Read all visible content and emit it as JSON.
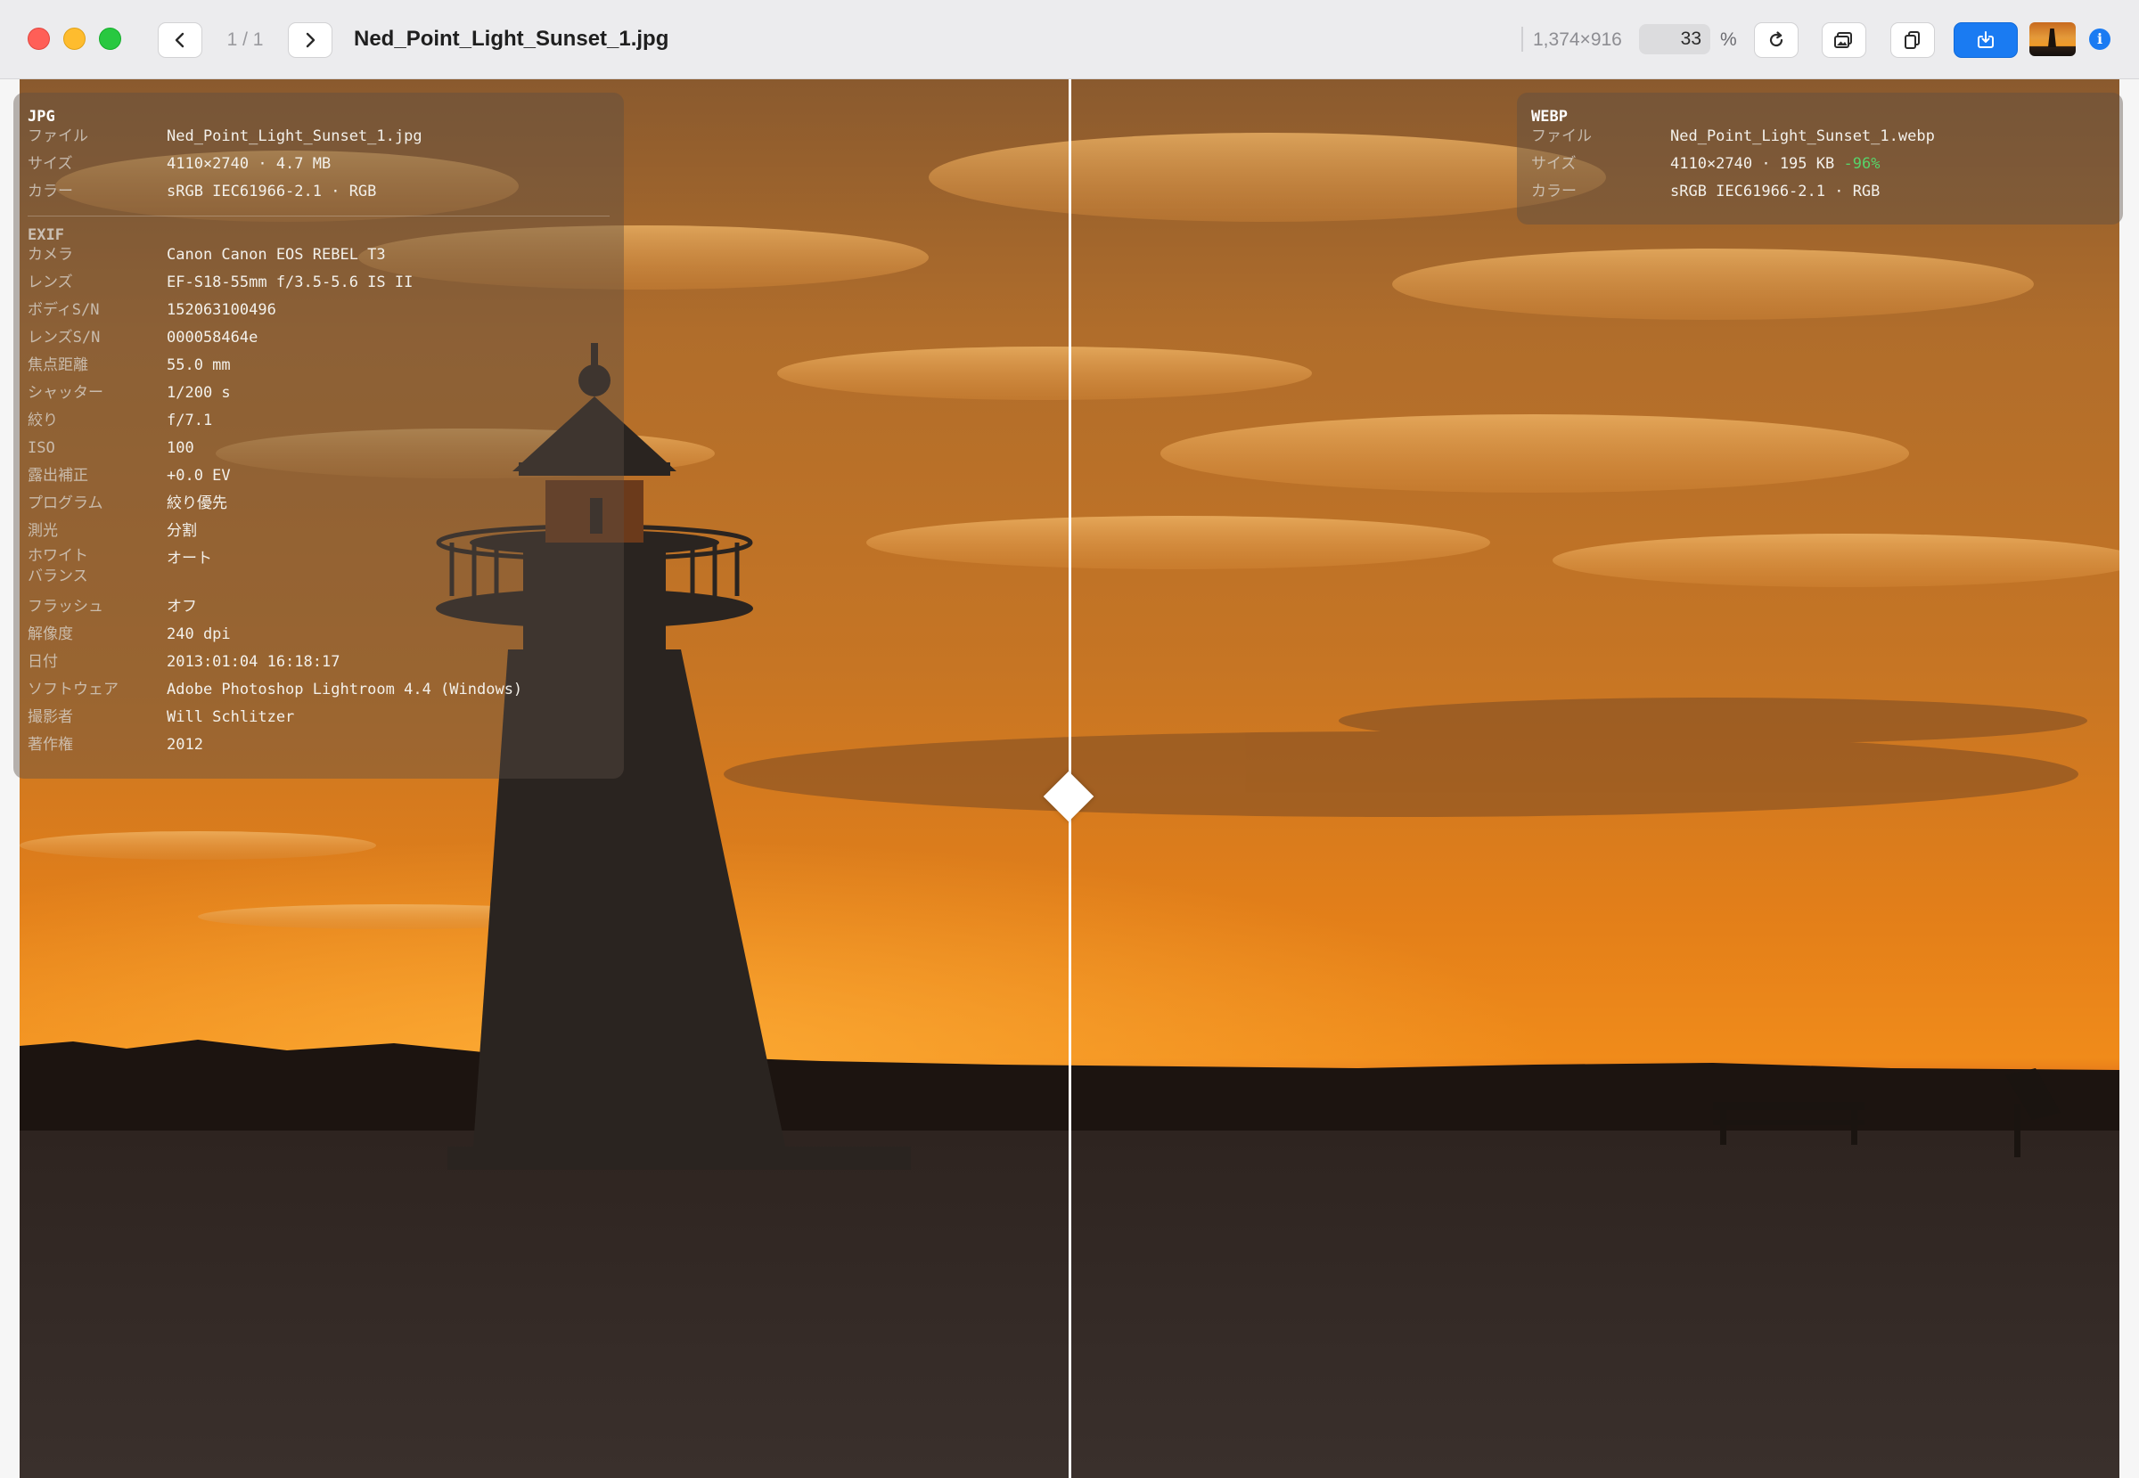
{
  "titlebar": {
    "counter": "1 / 1",
    "filename": "Ned_Point_Light_Sunset_1.jpg",
    "dimensions": "1,374×916",
    "zoom_value": "33",
    "zoom_unit": "%",
    "info_glyph": "i"
  },
  "icons": {
    "prev": "chevron-left-icon",
    "next": "chevron-right-icon",
    "rotate": "rotate-icon",
    "compare": "image-compare-icon",
    "copy": "copy-icon",
    "save": "save-download-icon",
    "info": "info-icon"
  },
  "colors": {
    "accent": "#1a7bf2",
    "size_delta": "#57d36a"
  },
  "left_panel": {
    "title": "JPG",
    "rows": [
      {
        "label": "ファイル",
        "value": "Ned_Point_Light_Sunset_1.jpg"
      },
      {
        "label": "サイズ",
        "value": "4110×2740 · 4.7 MB"
      },
      {
        "label": "カラー",
        "value": "sRGB IEC61966-2.1 · RGB"
      }
    ],
    "exif_title": "EXIF",
    "exif": [
      {
        "label": "カメラ",
        "value": "Canon Canon EOS REBEL T3"
      },
      {
        "label": "レンズ",
        "value": "EF-S18-55mm f/3.5-5.6 IS II"
      },
      {
        "label": "ボディS/N",
        "value": "152063100496"
      },
      {
        "label": "レンズS/N",
        "value": "000058464e"
      },
      {
        "label": "焦点距離",
        "value": "55.0 mm"
      },
      {
        "label": "シャッター",
        "value": "1/200 s"
      },
      {
        "label": "絞り",
        "value": "f/7.1"
      },
      {
        "label": "ISO",
        "value": "100"
      },
      {
        "label": "露出補正",
        "value": "+0.0 EV"
      },
      {
        "label": "プログラム",
        "value": "絞り優先"
      },
      {
        "label": "測光",
        "value": "分割"
      },
      {
        "label": "ホワイト\nバランス",
        "value": "オート"
      },
      {
        "label": "フラッシュ",
        "value": "オフ"
      },
      {
        "label": "解像度",
        "value": "240 dpi"
      },
      {
        "label": "日付",
        "value": "2013:01:04 16:18:17"
      },
      {
        "label": "ソフトウェア",
        "value": "Adobe Photoshop Lightroom 4.4 (Windows)"
      },
      {
        "label": "撮影者",
        "value": "Will Schlitzer"
      },
      {
        "label": "著作権",
        "value": "2012"
      }
    ]
  },
  "right_panel": {
    "title": "WEBP",
    "rows": [
      {
        "label": "ファイル",
        "value": "Ned_Point_Light_Sunset_1.webp"
      },
      {
        "label": "サイズ",
        "value": "4110×2740 · 195 KB",
        "delta": "-96%"
      },
      {
        "label": "カラー",
        "value": "sRGB IEC61966-2.1 · RGB"
      }
    ]
  }
}
